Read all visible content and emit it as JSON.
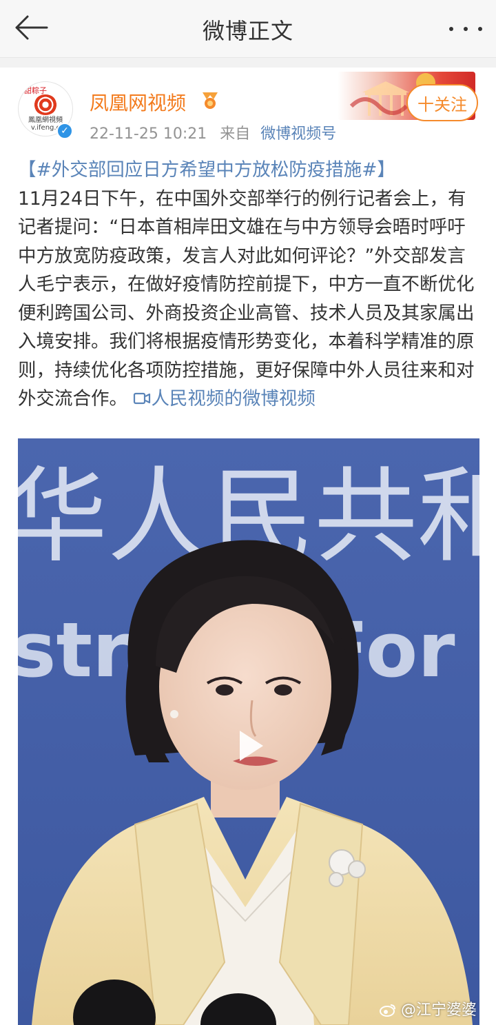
{
  "header": {
    "title": "微博正文"
  },
  "post": {
    "account_name": "凤凰网视频",
    "avatar_text": "鳳凰網視頻",
    "avatar_url_text": "v.ifeng.c",
    "avatar_tag": "甜粽子",
    "verified_mark": "✓",
    "timestamp": "22-11-25 10:21",
    "source_prefix": "来自",
    "source": "微博视频号",
    "follow_label": "十关注",
    "topic": "【#外交部回应日方希望中方放松防疫措施#】",
    "body": "11月24日下午，在中国外交部举行的例行记者会上，有记者提问：“日本首相岸田文雄在与中方领导会晤时呼吁中方放宽防疫政策，发言人对此如何评论？”外交部发言人毛宁表示，在做好疫情防控前提下，中方一直不断优化便利跨国公司、外商投资企业高管、技术人员及其家属出入境安排。我们将根据疫情形势变化，本着科学精准的原则，持续优化各项防控措施，更好保障中外人员往来和对外交流合作。",
    "video_link": "人民视频的微博视频",
    "video": {
      "backdrop_text_top": "华人民共和",
      "backdrop_text_mid": "stry of For",
      "watermark": "@江宁婆婆"
    }
  },
  "colors": {
    "accent_orange": "#f37b1d",
    "link_blue": "#5a84b8",
    "backdrop_blue": "#4563a8"
  }
}
